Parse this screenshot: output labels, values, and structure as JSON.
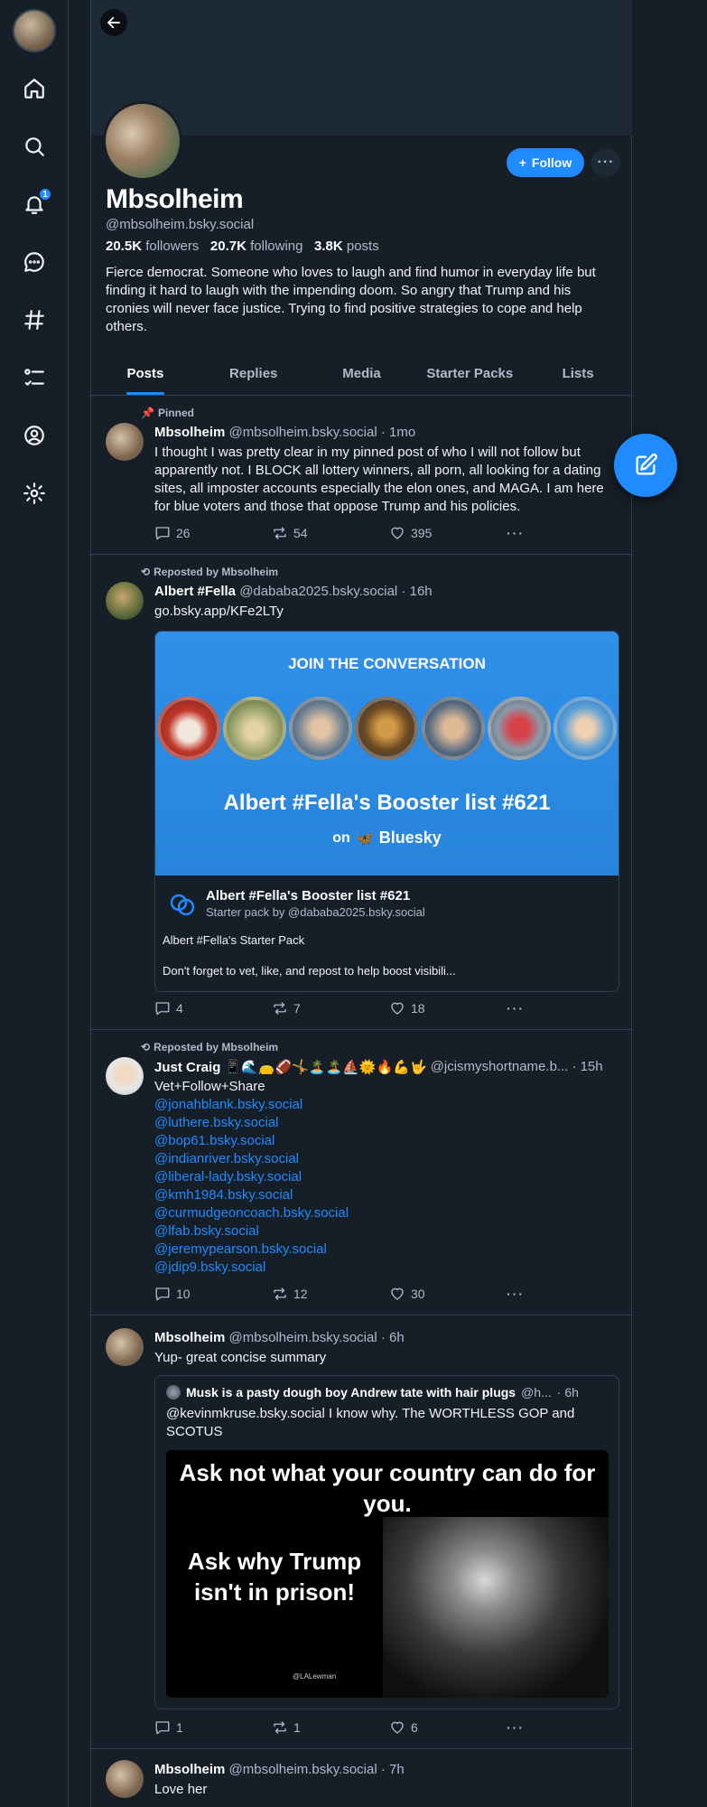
{
  "profile": {
    "display_name": "Mbsolheim",
    "handle": "@mbsolheim.bsky.social",
    "followers_count": "20.5K",
    "followers_label": "followers",
    "following_count": "20.7K",
    "following_label": "following",
    "posts_count": "3.8K",
    "posts_label": "posts",
    "bio": "Fierce democrat. Someone who loves to laugh and find humor in everyday life but finding it hard to laugh with the impending doom. So angry that Trump and his cronies will never face justice. Trying to find positive strategies to cope and help others.",
    "follow_label": "Follow",
    "more_label": "···"
  },
  "nav": {
    "notification_count": "1"
  },
  "tabs": [
    "Posts",
    "Replies",
    "Media",
    "Starter Packs",
    "Lists"
  ],
  "posts": [
    {
      "context": "Pinned",
      "author": "Mbsolheim",
      "handle": "@mbsolheim.bsky.social",
      "time": "· 1mo",
      "text": "I thought I was pretty clear in my pinned post of who I will not follow but apparently not. I BLOCK all lottery winners, all porn, all looking for a dating sites, all imposter accounts especially the elon ones, and MAGA. I am here for blue voters and those that oppose Trump and his policies.",
      "replies": "26",
      "reposts": "54",
      "likes": "395"
    },
    {
      "context": "Reposted by Mbsolheim",
      "author": "Albert #Fella",
      "handle": "@dababa2025.bsky.social",
      "time": "· 16h",
      "link": "go.bsky.app/KFe2LTy",
      "card": {
        "top_text": "JOIN THE CONVERSATION",
        "title": "Albert #Fella's Booster list #621",
        "on": "on",
        "brand": "Bluesky",
        "name": "Albert #Fella's Booster list #621",
        "by": "Starter pack by @dababa2025.bsky.social",
        "desc1": "Albert #Fella's Starter Pack",
        "desc2": "Don't forget to vet, like, and repost to help boost visibili..."
      },
      "replies": "4",
      "reposts": "7",
      "likes": "18"
    },
    {
      "context": "Reposted by Mbsolheim",
      "author": "Just Craig 📱🌊👝🏈🤸🏝️🏝️⛵🌞🔥💪🤟",
      "handle": "@jcismyshortname.b...",
      "time": "· 15h",
      "text": "Vet+Follow+Share",
      "mentions": [
        "@jonahblank.bsky.social",
        "@luthere.bsky.social",
        "@bop61.bsky.social",
        "@indianriver.bsky.social",
        "@liberal-lady.bsky.social",
        "@kmh1984.bsky.social",
        "@curmudgeoncoach.bsky.social",
        "@lfab.bsky.social",
        "@jeremypearson.bsky.social",
        "@jdip9.bsky.social"
      ],
      "replies": "10",
      "reposts": "12",
      "likes": "30"
    },
    {
      "author": "Mbsolheim",
      "handle": "@mbsolheim.bsky.social",
      "time": "· 6h",
      "text": "Yup- great concise summary",
      "quote": {
        "author": "Musk is a pasty dough boy Andrew tate with hair plugs",
        "handle": "@h...",
        "time": "· 6h",
        "text": "@kevinmkruse.bsky.social  I know why.  The WORTHLESS GOP and SCOTUS",
        "image_line1": "Ask not what your country can do for you.",
        "image_line2": "Ask why Trump isn't in prison!",
        "image_credit": "@LALewman"
      },
      "replies": "1",
      "reposts": "1",
      "likes": "6"
    },
    {
      "author": "Mbsolheim",
      "handle": "@mbsolheim.bsky.social",
      "time": "· 7h",
      "text": "Love her"
    }
  ],
  "colors": {
    "background": "#161e27",
    "accent": "#208bfe",
    "muted": "#aebbc9",
    "border": "#2e4052"
  }
}
